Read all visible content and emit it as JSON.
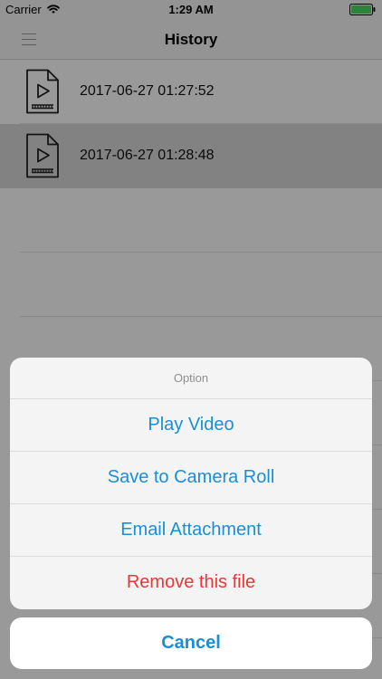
{
  "status_bar": {
    "carrier": "Carrier",
    "time": "1:29 AM",
    "wifi_icon": "wifi-icon",
    "battery_icon": "battery-icon",
    "battery_color": "#4cd964"
  },
  "nav": {
    "title": "History",
    "menu_icon": "hamburger-menu-icon"
  },
  "history": {
    "items": [
      {
        "label": "2017-06-27 01:27:52",
        "icon": "video-file-icon",
        "selected": false
      },
      {
        "label": "2017-06-27 01:28:48",
        "icon": "video-file-icon",
        "selected": true
      }
    ]
  },
  "action_sheet": {
    "title": "Option",
    "actions": [
      {
        "label": "Play Video",
        "style": "default"
      },
      {
        "label": "Save to Camera Roll",
        "style": "default"
      },
      {
        "label": "Email Attachment",
        "style": "default"
      },
      {
        "label": "Remove this file",
        "style": "destructive"
      }
    ],
    "cancel_label": "Cancel"
  },
  "colors": {
    "accent": "#1a8fd6",
    "destructive": "#e53935",
    "selected_row": "#d9d9d9"
  }
}
